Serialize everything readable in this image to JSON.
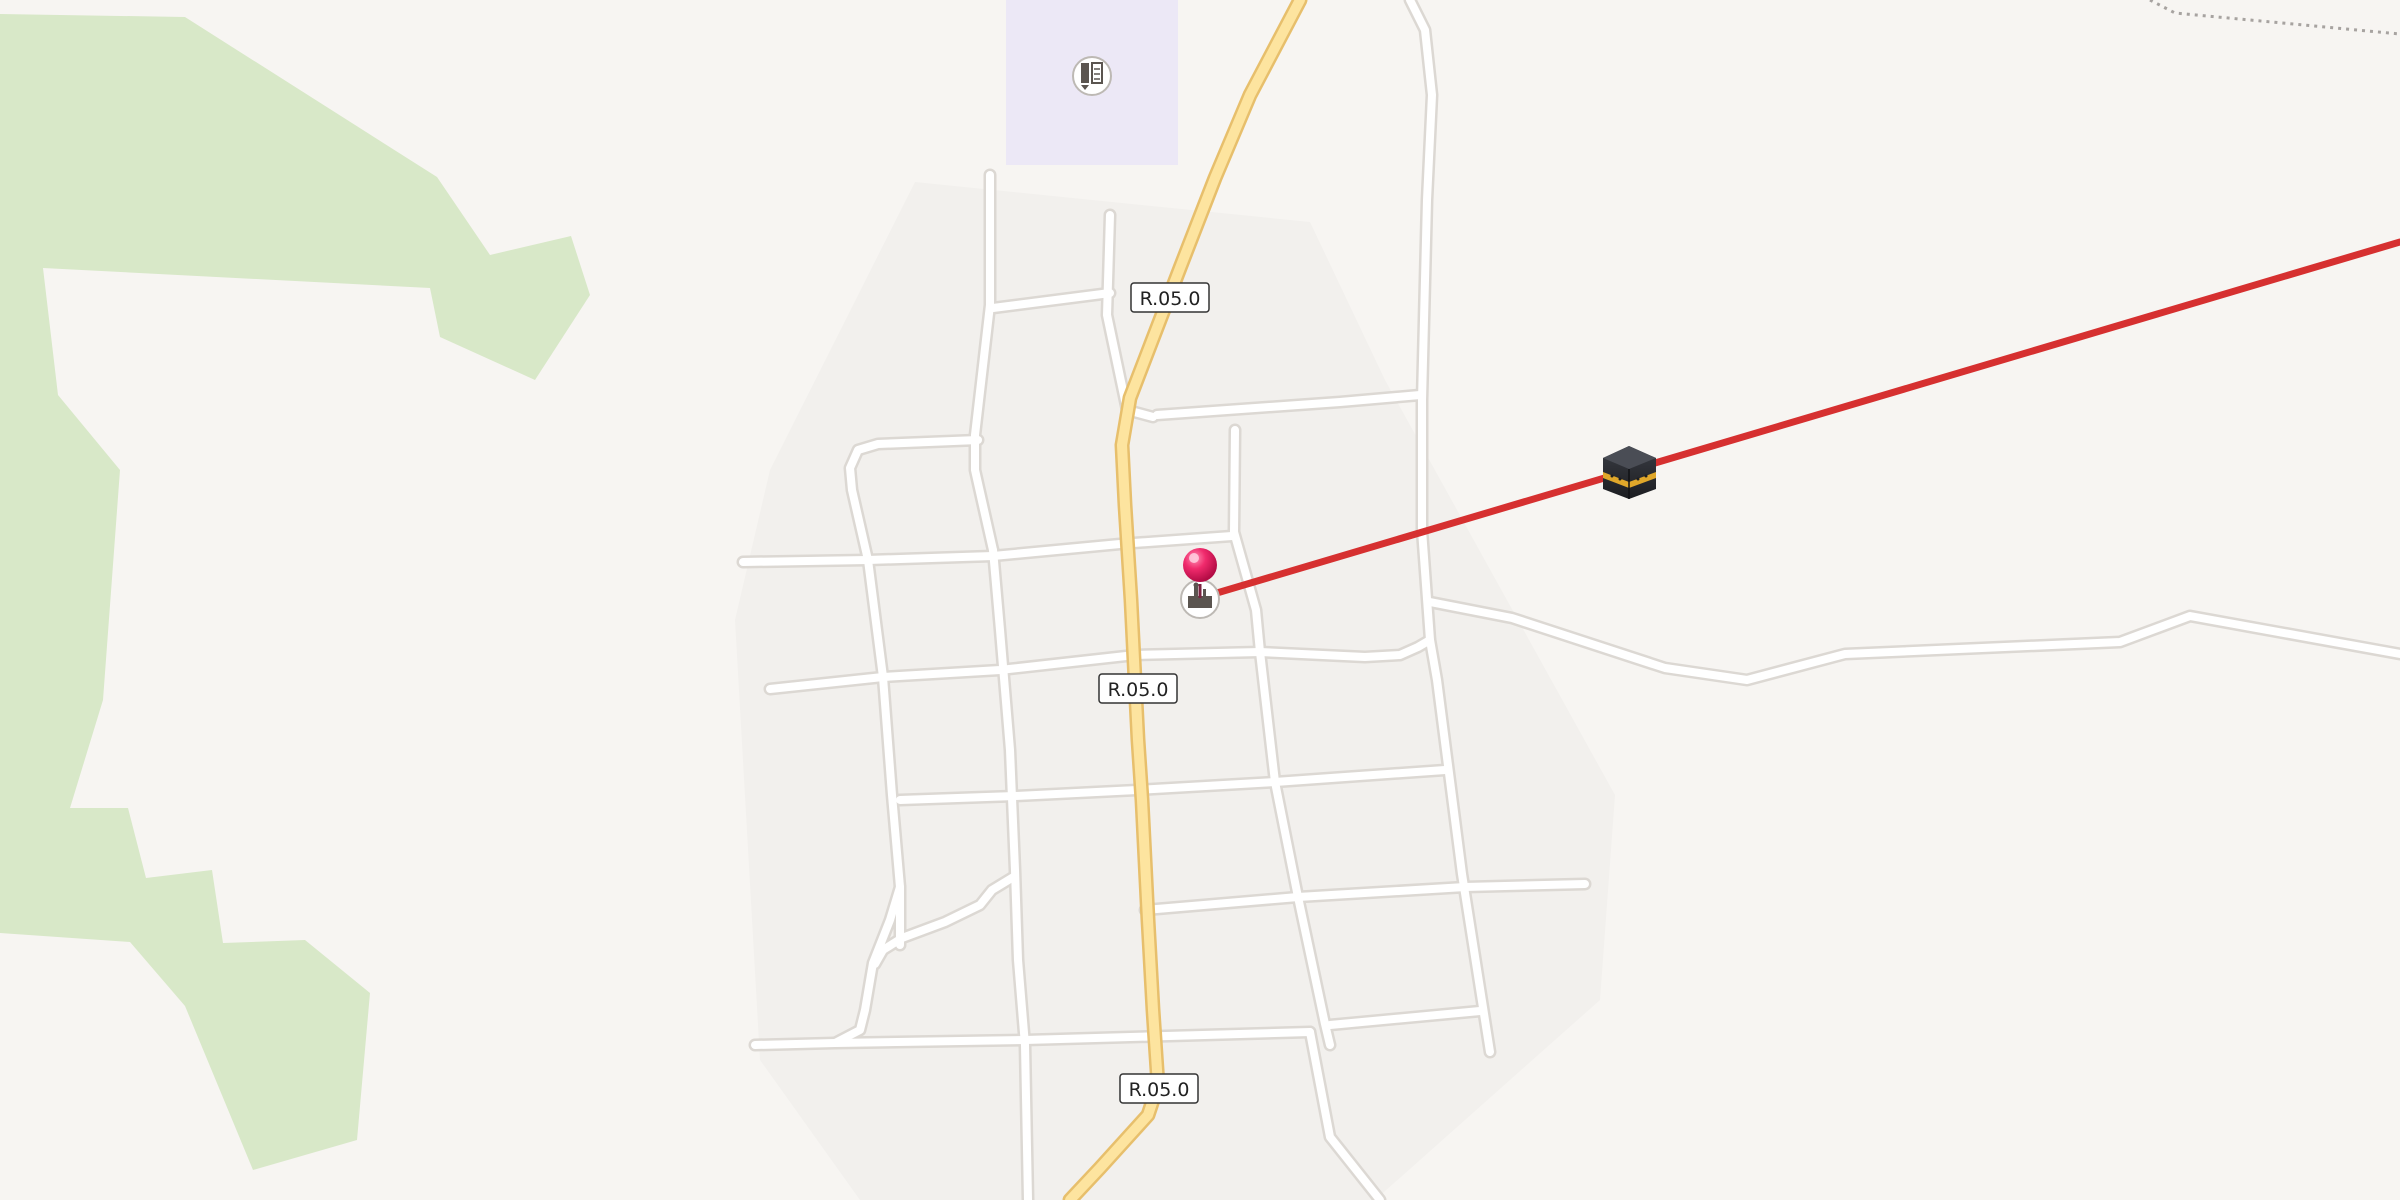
{
  "map": {
    "colors": {
      "background": "#f7f5f2",
      "settlement_area": "#f2f0ed",
      "forest": "#d8e8c8",
      "school_area": "#ece8f6",
      "street": "#ffffff",
      "street_casing": "#dcd8d3",
      "highway_fill": "#fde49f",
      "highway_casing": "#e7bf6c",
      "route_line": "#d63030",
      "boundary": "#a7a3a0",
      "pin": "#e8175d"
    },
    "road_labels": [
      "R.05.0",
      "R.05.0",
      "R.05.0"
    ],
    "markers": {
      "school": {
        "icon": "school-book-icon"
      },
      "mosque": {
        "icon": "mosque-icon"
      },
      "selected_location": {
        "icon": "map-pin-icon"
      },
      "qibla": {
        "icon": "kaaba-icon"
      }
    },
    "overlays": {
      "qibla_direction_line": true
    }
  }
}
